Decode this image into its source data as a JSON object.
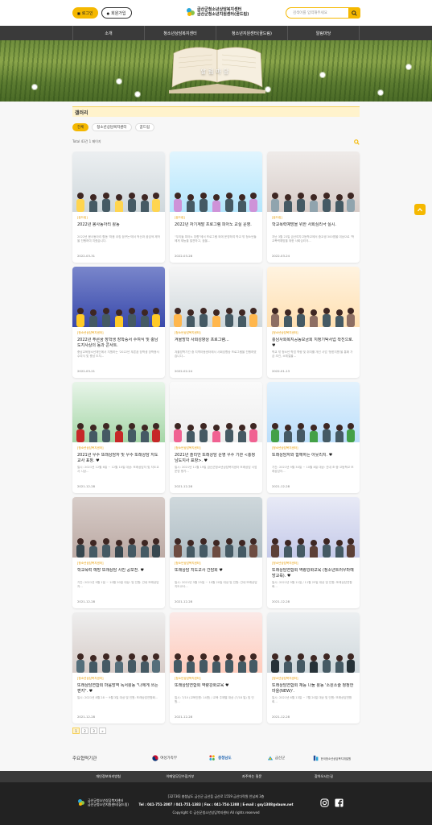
{
  "header": {
    "login_label": "로그인",
    "join_label": "회원가입",
    "logo_line1": "금산군청소년상담복지센터",
    "logo_line2": "금산군청소년지원센터(꿈드림)",
    "search_placeholder": "검색어를 입력해주세요"
  },
  "nav": [
    "소개",
    "청소년상담복지센터",
    "청소년지원센터(꿈드림)",
    "알림마당"
  ],
  "banner": {
    "title": "알림마당"
  },
  "section_title": "갤러리",
  "filters": [
    "전체",
    "청소년상담복지센터",
    "꿈드림"
  ],
  "total_text": "Total 43건 1 페이지",
  "cards": [
    {
      "cat": "[꿈드림]",
      "title": "2022년 봉사동아리 활동",
      "desc": "2022년 봉사동아리 활동 '마음 쿠킹 꿈꾸는'에서 먹산과 꿈검색 제작을 진행하여 지켰습니다.",
      "date": "2022-03-31"
    },
    {
      "cat": "[꿈드림]",
      "title": "2022년 자기계발 프로그램 피아노 교실 운영.",
      "desc": "\"우리들 피아노 취향\"에서 프로그램 외에 운영하여 학교 밖 청소년들에게 재능을 발견하고, 꿈을...",
      "date": "2022-03-28"
    },
    {
      "cat": "[꿈드림]",
      "title": "학교폭력예방을 위한 사회심리극 실시.",
      "desc": "지난 3월 23일 금산여자고등학교에서 중교생 300명을 대상으로 '학교폭력예방을 위한 사회심리극...",
      "date": "2022-03-24"
    },
    {
      "cat": "[청소년상담복지센터]",
      "title": "2022년 푸른꿈 장학생 장학증서 수여식 및 충남 도지사상의 동과 콘서트.",
      "desc": "충남교육청소년재단에서 지원하는 '2022년 푸른꿈 장학생 장학증서 수여식 및 충남 도지...",
      "date": "2022-03-21"
    },
    {
      "cat": "[청소년상담복지센터]",
      "title": "겨울방학 사회성향상 프로그램...",
      "desc": "겨울방학기간 중 지역아동센터에서 사회성향상 프로그램을 진행하였습니다...",
      "date": "2022-02-24"
    },
    {
      "cat": "[청소년상담복지센터]",
      "title": "충남사회복지공동모금회 지정기탁사업 착진으로. ♥",
      "desc": "학교 밖 청소년 학업 역량 및 취미를 개선 사업 '청힌지원'을 통해 가금 조건, 소체절을...",
      "date": "2022-01-13"
    },
    {
      "cat": "[청소년상담복지센터]",
      "title": "2021년 우수 또래상담자 및 우수 또래상담 지도교사 표창. ♥",
      "desc": "일시: 2021년 12월 6일 ~ 12월 10일 대상: 또래상담자 및 지도교사 시상...",
      "date": "2021-12-28"
    },
    {
      "cat": "[청소년상담복지센터]",
      "title": "2021년 솔리언 또래상담 운영 우수 기관 <충청남도지사 표창>. ♥",
      "desc": "일시: 2021년 11월 19일 금산군청소년상담복지센터 또래상담 사업 운영 평가...",
      "date": "2021-12-28"
    },
    {
      "cat": "[청소년상담복지센터]",
      "title": "또래상담자와 함께하는 아웃리치. ♥",
      "desc": "기간: 2021년 9월 30일 ~ 10월 8일 대상: 관내 초·중·고등학교 또래상담자...",
      "date": "2021-12-28"
    },
    {
      "cat": "[청소년상담복지센터]",
      "title": "학교폭력 예방 또래상담 사진 공모전. ♥",
      "desc": "기간: 2021년 9월 1일 ~ 10월 20일 대상: 및 인원: 관내 또래상담자...",
      "date": "2021-12-28"
    },
    {
      "cat": "[청소년상담복지센터]",
      "title": "또래상담 지도교사 간담회 ♥",
      "desc": "일시: 2021년 3월 25일 ~ 10월 20일 대상 및 인원: 관내 또래상담 지도교사...",
      "date": "2021-12-28"
    },
    {
      "cat": "[청소년상담복지센터]",
      "title": "또래상담연합회 역량강화교육 (청소년트러우마예방교육). ♥",
      "desc": "일시: 2021년 9월 11일 / 11월 25일 대상 및 인원: 또래상담연합회...",
      "date": "2021-12-28"
    },
    {
      "cat": "[청소년상담복지센터]",
      "title": "또래상담연합회 마음방역 독서활동 \"나에게 쓰는 편지\". ♥",
      "desc": "일시: 2021년 8월 28 ~ 9월 3일 대상 및 인원: 또래상담연합회...",
      "date": "2021-12-28"
    },
    {
      "cat": "[청소년상담복지센터]",
      "title": "또래상담연합회 역량강화교육 ♥",
      "desc": "일시: 7/10 (교육인원: 14명) / 교육 주제별 대상 (7/18 일) 및 인원...",
      "date": "2021-12-28"
    },
    {
      "cat": "[청소년상담복지센터]",
      "title": "또래상담연합회 재능 나눔 활동 '소원소술 청정한 마을(NEW)'.",
      "desc": "일시: 2021년 6월 13일 ~ 7월 20일 대상 및 인원: 또래상담연합회...",
      "date": "2021-12-28"
    }
  ],
  "pages": [
    "1",
    "2",
    "3",
    "»"
  ],
  "partners": {
    "title": "주요협력기관",
    "items": [
      "여성가족부",
      "충청남도",
      "금산군",
      "한국청소년상담복지개발원"
    ]
  },
  "footer_links": [
    "개인정보처리방침",
    "이메일무단수집거부",
    "자주하는 질문",
    "찾아오시는길"
  ],
  "footer": {
    "logo_line1": "금산군청소년상담복지센터",
    "logo_line2": "금산군청소년지원센터(꿈드림)",
    "address": "[32736] 충청남도 금산군 금산읍 금산로 1559 금산다락원 안남제 3층",
    "contact": "Tel : 041-751-2007 / 041-751-1383 | Fax : 041-754-1388 | E-mail : gsy1388@daum.net",
    "copyright": "Copyright © 금산군청소년상담복지센터 All rights reserved"
  },
  "colors": {
    "accent": "#f5b800",
    "nav": "#3a3a3a",
    "footer": "#222222"
  }
}
